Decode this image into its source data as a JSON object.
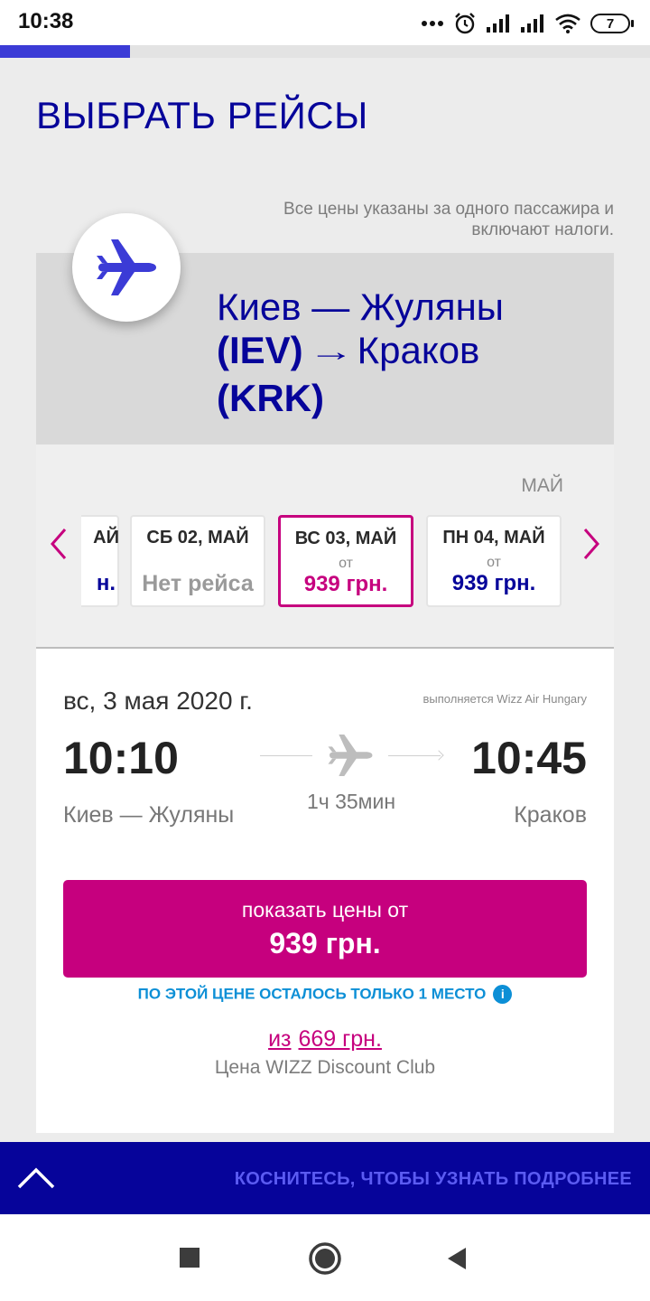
{
  "status_bar": {
    "time": "10:38",
    "icons": [
      "more-dots-icon",
      "alarm-icon",
      "signal-icon",
      "signal-icon",
      "wifi-icon",
      "battery-icon"
    ],
    "battery_level": "7"
  },
  "progress": {
    "fraction": 0.2
  },
  "header": {
    "title": "ВЫБРАТЬ РЕЙСЫ",
    "price_note": "Все цены указаны за одного пассажира и включают налоги."
  },
  "route": {
    "line1": "Киев — Жуляны",
    "line2_code": "(IEV)",
    "arrow": "→",
    "line2_dest": "Краков",
    "line3": "(KRK)"
  },
  "dates": {
    "month": "МАЙ",
    "cards": [
      {
        "day": "АЙ",
        "price": "н."
      },
      {
        "day": "СБ 02, МАЙ",
        "no_flight": "Нет рейса"
      },
      {
        "day": "ВС 03, МАЙ",
        "from": "от",
        "price": "939 грн.",
        "selected": true
      },
      {
        "day": "ПН 04, МАЙ",
        "from": "от",
        "price": "939 грн."
      }
    ]
  },
  "flight": {
    "date": "вс, 3 мая 2020 г.",
    "operator": "выполняется Wizz Air Hungary",
    "departure_time": "10:10",
    "arrival_time": "10:45",
    "departure_city": "Киев — Жуляны",
    "arrival_city": "Краков",
    "duration": "1ч 35мин",
    "button_line1": "показать цены от",
    "button_line2": "939 грн.",
    "seats_notice": "ПО ЭТОЙ ЦЕНЕ ОСТАЛОСЬ ТОЛЬКО 1 МЕСТО",
    "info_glyph": "i",
    "club_from": "из",
    "club_price": "669 грн.",
    "club_label": "Цена WIZZ Discount Club"
  },
  "banner": {
    "text": "КОСНИТЕСЬ, ЧТОБЫ УЗНАТЬ ПОДРОБНЕЕ"
  },
  "system_nav": {
    "icons": [
      "recents-square-icon",
      "home-circle-icon",
      "back-triangle-icon"
    ]
  },
  "colors": {
    "brand_blue": "#06049a",
    "accent_magenta": "#c6007e",
    "info_blue": "#0c8fd6",
    "progress_blue": "#3b3bd6"
  }
}
